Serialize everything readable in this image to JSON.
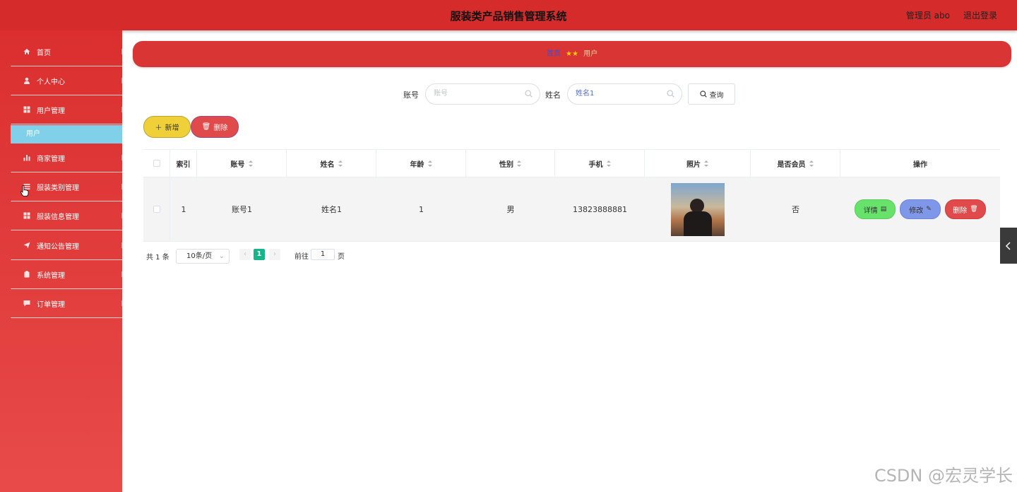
{
  "header": {
    "title": "服装类产品销售管理系统",
    "admin": "管理员 abo",
    "logout": "退出登录"
  },
  "sidebar": {
    "items": [
      {
        "label": "首页",
        "icon": "home-icon"
      },
      {
        "label": "个人中心",
        "icon": "user-icon"
      },
      {
        "label": "用户管理",
        "icon": "grid-icon"
      },
      {
        "label": "商家管理",
        "icon": "bar-chart-icon"
      },
      {
        "label": "服装类别管理",
        "icon": "list-icon"
      },
      {
        "label": "服装信息管理",
        "icon": "grid-icon"
      },
      {
        "label": "通知公告管理",
        "icon": "send-icon"
      },
      {
        "label": "系统管理",
        "icon": "clipboard-icon"
      },
      {
        "label": "订单管理",
        "icon": "chat-icon"
      }
    ],
    "submenu_active": "用户"
  },
  "breadcrumb": {
    "home": "首页",
    "separator": "★★",
    "current": "用户"
  },
  "search": {
    "account_label": "账号",
    "account_placeholder": "账号",
    "account_value": "",
    "name_label": "姓名",
    "name_value": "姓名1",
    "query_label": "查询"
  },
  "actions": {
    "add_label": "新增",
    "delete_label": "删除"
  },
  "table": {
    "columns": [
      "索引",
      "账号",
      "姓名",
      "年龄",
      "性别",
      "手机",
      "照片",
      "是否会员",
      "操作"
    ],
    "rows": [
      {
        "index": "1",
        "account": "账号1",
        "name": "姓名1",
        "age": "1",
        "gender": "男",
        "phone": "13823888881",
        "member": "否"
      }
    ],
    "op_detail": "详情",
    "op_edit": "修改",
    "op_delete": "删除"
  },
  "pagination": {
    "total": "共 1 条",
    "page_size": "10条/页",
    "current_page": "1",
    "goto_prefix": "前往",
    "goto_value": "1",
    "goto_suffix": "页"
  },
  "watermark": "CSDN @宏灵学长",
  "colors": {
    "primary_red": "#d52b2b",
    "submenu_active": "#7fd0e8",
    "add_yellow": "#f0d038",
    "detail_green": "#67e26a",
    "edit_blue": "#7f97e8",
    "page_active": "#18b48a"
  }
}
